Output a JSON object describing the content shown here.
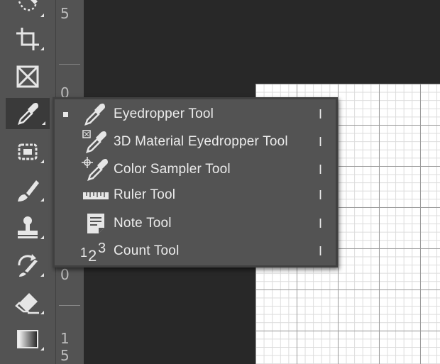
{
  "ruler": {
    "n1": "5",
    "n2": "0",
    "n3": "0",
    "n4": "1",
    "n5": "5"
  },
  "flyout": {
    "items": [
      {
        "label": "Eyedropper Tool",
        "shortcut": "I",
        "selected": true
      },
      {
        "label": "3D Material Eyedropper Tool",
        "shortcut": "I"
      },
      {
        "label": "Color Sampler Tool",
        "shortcut": "I"
      },
      {
        "label": "Ruler Tool",
        "shortcut": "I"
      },
      {
        "label": "Note Tool",
        "shortcut": "I"
      },
      {
        "label": "Count Tool",
        "shortcut": "I"
      }
    ]
  },
  "icons": {
    "toolbar": [
      "lasso-icon",
      "crop-icon",
      "frame-icon",
      "eyedropper-icon",
      "patch-icon",
      "brush-icon",
      "stamp-icon",
      "history-brush-icon",
      "eraser-icon",
      "gradient-icon"
    ],
    "count_glyph_1": "1",
    "count_glyph_2": "2",
    "count_glyph_3": "3"
  },
  "colors": {
    "toolbar_bg": "#535353",
    "workspace_bg": "#282828",
    "menu_bg": "#535353",
    "menu_border": "#404040",
    "text": "#ececec"
  }
}
